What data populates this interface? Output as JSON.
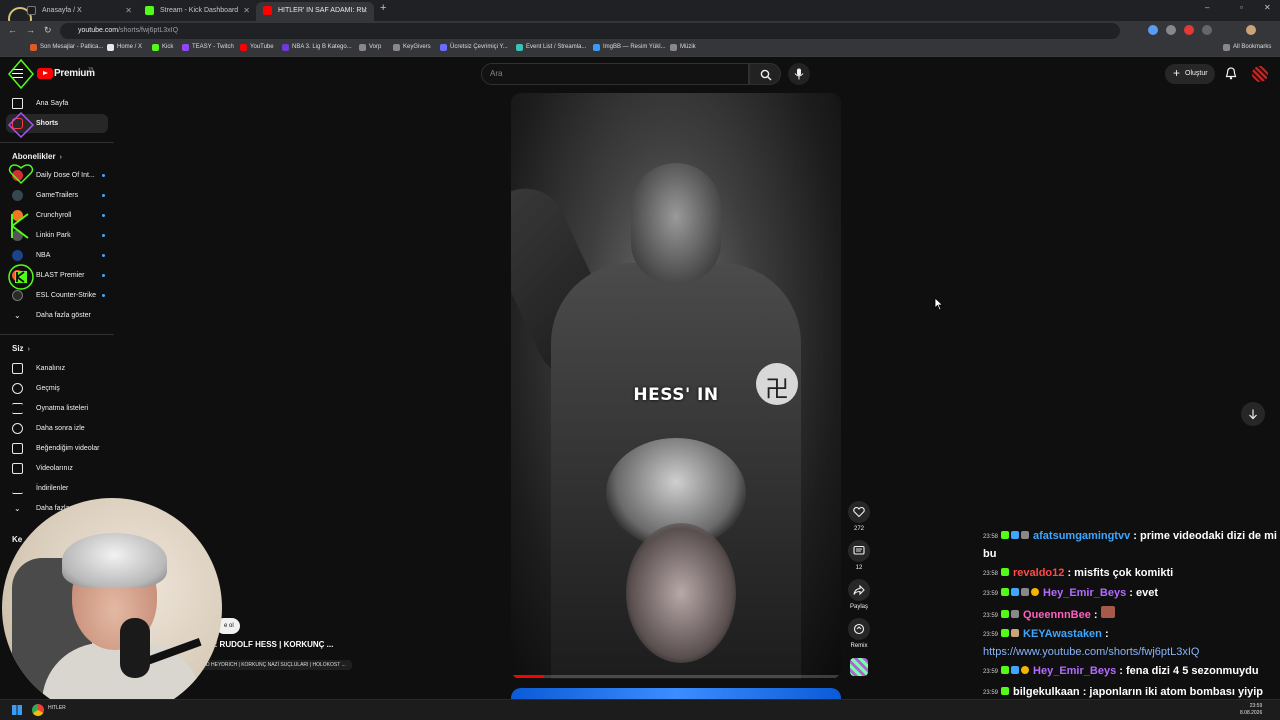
{
  "browser": {
    "tabs": [
      {
        "title": "Anasayfa / X",
        "color": "#1d1d1d",
        "active": false
      },
      {
        "title": "Stream - Kick Dashboard",
        "color": "#53fc18",
        "active": false
      },
      {
        "title": "HITLER' IN SAF ADAMI: RU",
        "color": "#ff0000",
        "active": true
      }
    ],
    "url_host": "youtube.com",
    "url_path": "/shorts/fwj6ptL3xIQ",
    "bookmarks": [
      {
        "label": "Son Mesajlar - Patlica...",
        "color": "#e05a28"
      },
      {
        "label": "Home / X",
        "color": "#e8eaed"
      },
      {
        "label": "Kick",
        "color": "#53fc18"
      },
      {
        "label": "TEASY - Twitch",
        "color": "#9146ff"
      },
      {
        "label": "YouTube",
        "color": "#ff0000"
      },
      {
        "label": "NBA 3. Lig B Katego...",
        "color": "#6f3ad8"
      },
      {
        "label": "Vorp",
        "color": "#888888"
      },
      {
        "label": "KeyGivers",
        "color": "#888888"
      },
      {
        "label": "Ücretsiz Çevrimiçi Y...",
        "color": "#6b6bff"
      },
      {
        "label": "Event List / Streamla...",
        "color": "#39c0ba"
      },
      {
        "label": "ImgBB — Resim Yükl...",
        "color": "#3b9bf3"
      },
      {
        "label": "Müzik",
        "color": "#888888"
      }
    ],
    "all_bookmarks": "All Bookmarks"
  },
  "youtube": {
    "brand": "Premium",
    "region": "TR",
    "search_placeholder": "Ara",
    "create_label": "Oluştur"
  },
  "sidebar": {
    "main": [
      {
        "label": "Ana Sayfa",
        "icon": "home-icon",
        "active": false
      },
      {
        "label": "Shorts",
        "icon": "shorts-icon",
        "active": true
      }
    ],
    "subs_heading": "Abonelikler",
    "subscriptions": [
      {
        "label": "Daily Dose Of Int...",
        "color": "#d32f2f"
      },
      {
        "label": "GameTrailers",
        "color": "#37474f"
      },
      {
        "label": "Crunchyroll",
        "color": "#f47521"
      },
      {
        "label": "Linkin Park",
        "color": "#555555"
      },
      {
        "label": "NBA",
        "color": "#1d428a"
      },
      {
        "label": "BLAST Premier",
        "color": "#ff5722"
      },
      {
        "label": "ESL Counter-Strike",
        "color": "#2a2a2a"
      }
    ],
    "show_more": "Daha fazla göster",
    "you_heading": "Siz",
    "you_items": [
      {
        "label": "Kanalınız",
        "icon": "channel-icon"
      },
      {
        "label": "Geçmiş",
        "icon": "history-icon"
      },
      {
        "label": "Oynatma listeleri",
        "icon": "playlists-icon"
      },
      {
        "label": "Daha sonra izle",
        "icon": "watch-later-icon"
      },
      {
        "label": "Beğendiğim videolar",
        "icon": "like-icon"
      },
      {
        "label": "Videolarınız",
        "icon": "your-videos-icon"
      },
      {
        "label": "İndirilenler",
        "icon": "download-icon"
      },
      {
        "label": "Daha fazla",
        "icon": "chevron-down-icon"
      }
    ],
    "partial_heading": "Ke"
  },
  "short": {
    "caption": "HESS' IN",
    "progress": 0.1,
    "likes": "272",
    "comments": "12",
    "share_label": "Paylaş",
    "remix_label": "Remix"
  },
  "overlay": {
    "subscribe_partial": "e ol",
    "title_partial": "AMI: RUDOLF HESS | KORKUNÇ ...",
    "desc_partial": "D HEYDRICH | KORKUNÇ NAZİ SUÇLULARI | HOLOKOST ..."
  },
  "chat": [
    {
      "time": "23:58",
      "user": "afatsumgamingtvv",
      "color": "#3ea6ff",
      "text": " : prime videodaki dizi de mi bu"
    },
    {
      "time": "23:58",
      "user": "revaldo12",
      "color": "#ff4a4a",
      "text": " : misfits çok komikti"
    },
    {
      "time": "23:59",
      "user": "Hey_Emir_Beys",
      "color": "#b36bff",
      "text": " : evet"
    },
    {
      "time": "23:59",
      "user": "QueennnBee",
      "color": "#ff5fc0",
      "text": " : "
    },
    {
      "time": "23:59",
      "user": "KEYAwastaken",
      "color": "#3ea6ff",
      "text": " :",
      "link": "https://www.youtube.com/shorts/fwj6ptL3xIQ"
    },
    {
      "time": "23:59",
      "user": "Hey_Emir_Beys",
      "color": "#b36bff",
      "text": " : fena dizi 4 5 sezonmuydu"
    },
    {
      "time": "23:59",
      "user": "bilgekulkaan",
      "color": "#ffffff",
      "text": " : japonların iki atom bombası yiyip buralara gelmeleri çok ilginç"
    }
  ],
  "taskbar": {
    "time": "23:59",
    "date": "8.08.2026",
    "app_label": "HITLER"
  }
}
